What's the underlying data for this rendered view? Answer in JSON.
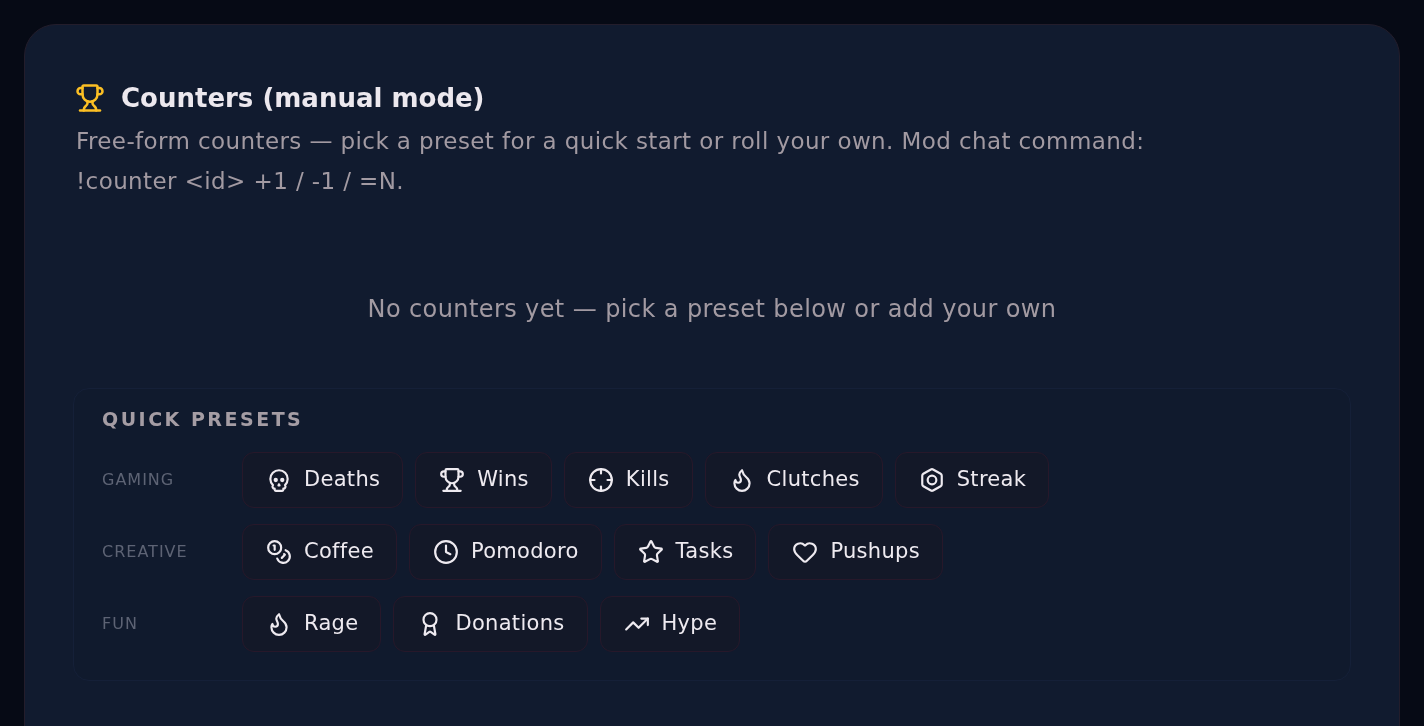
{
  "section": {
    "title": "Counters (manual mode)",
    "description": "Free-form counters — pick a preset for a quick start or roll your own. Mod chat command: !counter <id> +1 / -1 / =N."
  },
  "empty_state": "No counters yet — pick a preset below or add your own",
  "presets": {
    "heading": "QUICK PRESETS",
    "groups": [
      {
        "label": "GAMING",
        "items": [
          {
            "label": "Deaths"
          },
          {
            "label": "Wins"
          },
          {
            "label": "Kills"
          },
          {
            "label": "Clutches"
          },
          {
            "label": "Streak"
          }
        ]
      },
      {
        "label": "CREATIVE",
        "items": [
          {
            "label": "Coffee"
          },
          {
            "label": "Pomodoro"
          },
          {
            "label": "Tasks"
          },
          {
            "label": "Pushups"
          }
        ]
      },
      {
        "label": "FUN",
        "items": [
          {
            "label": "Rage"
          },
          {
            "label": "Donations"
          },
          {
            "label": "Hype"
          }
        ]
      }
    ]
  }
}
